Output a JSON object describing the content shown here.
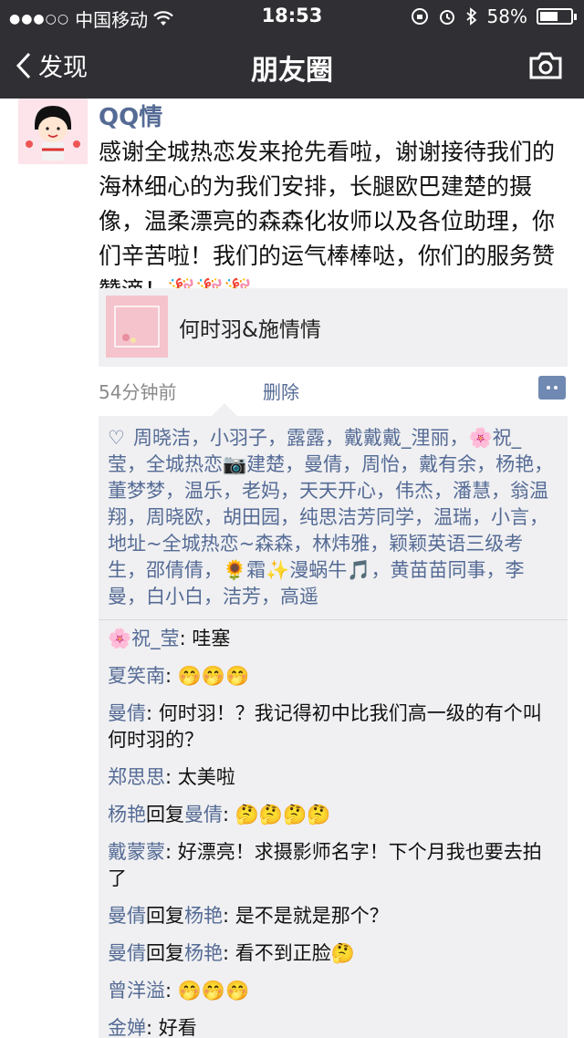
{
  "status_bar": {
    "carrier": "中国移动",
    "time": "18:53",
    "battery": "58%",
    "battery_level": 0.58
  },
  "nav": {
    "back_label": "发现",
    "title": "朋友圈"
  },
  "post": {
    "author": "QQ情",
    "text": "感谢全城热恋发来抢先看啦，谢谢接待我们的海林细心的为我们安排，长腿欧巴建楚的摄像，温柔漂亮的森森化妆师以及各位助理，你们辛苦啦！我们的运气棒棒哒，你们的服务赞赞滴！🎉🎉🎉",
    "share_title": "何时羽&施情情",
    "time": "54分钟前",
    "delete_label": "删除"
  },
  "likes": "周晓洁，小羽子，露露，戴戴戴_浬丽，🌸祝_莹，全城热恋📷建楚，曼倩，周怡，戴有余，杨艳，董梦梦，温乐，老妈，天天开心，伟杰，潘慧，翁温翔，周晓欧，胡田园，纯思洁芳同学，温瑞，小言，地址~全城热恋~森森，林炜雅，颖颖英语三级考生，邵倩倩，🌻霜✨漫蜗牛🎵，黄苗苗同事，李曼，白小白，洁芳，高遥",
  "comments": [
    {
      "name": "🌸祝_莹",
      "reply_word": "",
      "reply_to": "",
      "text": ": 哇塞"
    },
    {
      "name": "夏笑南",
      "reply_word": "",
      "reply_to": "",
      "text": ": 🤭🤭🤭"
    },
    {
      "name": "曼倩",
      "reply_word": "",
      "reply_to": "",
      "text": ": 何时羽！？我记得初中比我们高一级的有个叫何时羽的？"
    },
    {
      "name": "郑思思",
      "reply_word": "",
      "reply_to": "",
      "text": ": 太美啦"
    },
    {
      "name": "杨艳",
      "reply_word": "回复",
      "reply_to": "曼倩",
      "text": ": 🤔🤔🤔🤔"
    },
    {
      "name": "戴蒙蒙",
      "reply_word": "",
      "reply_to": "",
      "text": ": 好漂亮！求摄影师名字！下个月我也要去拍了"
    },
    {
      "name": "曼倩",
      "reply_word": "回复",
      "reply_to": "杨艳",
      "text": ": 是不是就是那个？"
    },
    {
      "name": "曼倩",
      "reply_word": "回复",
      "reply_to": "杨艳",
      "text": ": 看不到正脸🤔"
    },
    {
      "name": "曾洋溢",
      "reply_word": "",
      "reply_to": "",
      "text": ": 🤭🤭🤭"
    },
    {
      "name": "金婵",
      "reply_word": "",
      "reply_to": "",
      "text": ": 好看"
    }
  ]
}
